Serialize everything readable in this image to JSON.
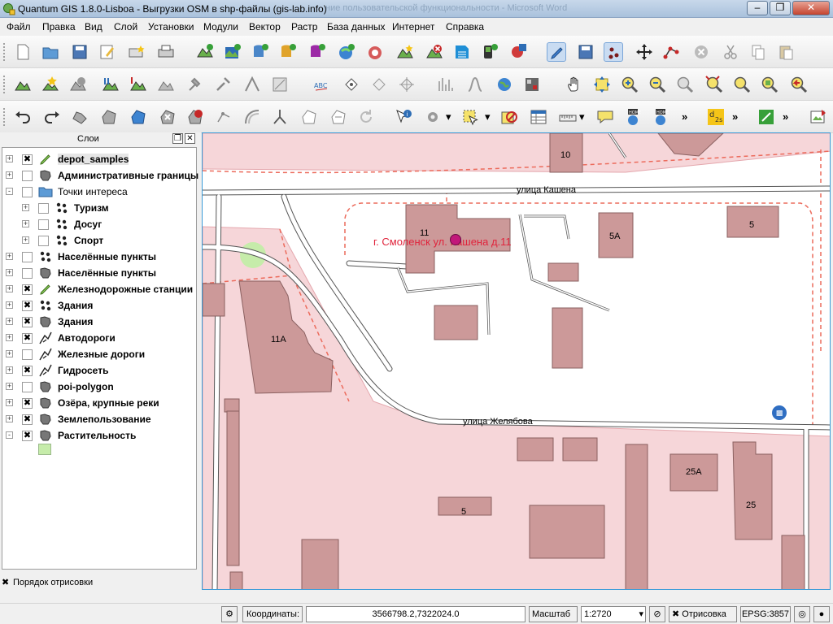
{
  "window": {
    "title": "Quantum GIS 1.8.0-Lisboa - Выгрузки OSM в shp-файлы (gis-lab.info)",
    "background_title": "ние пользовательской функциональности - Microsoft Word"
  },
  "menu": [
    "Файл",
    "Правка",
    "Вид",
    "Слой",
    "Установки",
    "Модули",
    "Вектор",
    "Растр",
    "База данных",
    "Интернет",
    "Справка"
  ],
  "layers_panel": {
    "title": "Слои",
    "items": [
      {
        "name": "depot_samples",
        "checked": true,
        "icon": "pencil-edit-icon",
        "expander": "+",
        "indent": 0,
        "bold": true
      },
      {
        "name": "Административные границы",
        "checked": false,
        "icon": "polygon-layer-icon",
        "expander": "+",
        "indent": 0,
        "bold": true
      },
      {
        "name": "Точки интереса",
        "checked": false,
        "icon": "folder-group-icon",
        "expander": "-",
        "indent": 0,
        "bold": false
      },
      {
        "name": "Туризм",
        "checked": false,
        "icon": "point-layer-icon",
        "expander": "+",
        "indent": 1,
        "bold": true
      },
      {
        "name": "Досуг",
        "checked": false,
        "icon": "point-layer-icon",
        "expander": "+",
        "indent": 1,
        "bold": true
      },
      {
        "name": "Спорт",
        "checked": false,
        "icon": "point-layer-icon",
        "expander": "+",
        "indent": 1,
        "bold": true
      },
      {
        "name": "Населённые пункты",
        "checked": false,
        "icon": "point-layer-icon",
        "expander": "+",
        "indent": 0,
        "bold": true
      },
      {
        "name": "Населённые пункты",
        "checked": false,
        "icon": "polygon-layer-icon",
        "expander": "+",
        "indent": 0,
        "bold": true
      },
      {
        "name": "Железнодорожные станции",
        "checked": true,
        "icon": "pencil-edit-icon",
        "expander": "+",
        "indent": 0,
        "bold": true
      },
      {
        "name": "Здания",
        "checked": true,
        "icon": "point-layer-icon",
        "expander": "+",
        "indent": 0,
        "bold": true
      },
      {
        "name": "Здания",
        "checked": true,
        "icon": "polygon-layer-icon",
        "expander": "+",
        "indent": 0,
        "bold": true
      },
      {
        "name": "Автодороги",
        "checked": true,
        "icon": "line-layer-icon",
        "expander": "+",
        "indent": 0,
        "bold": true
      },
      {
        "name": "Железные дороги",
        "checked": false,
        "icon": "line-layer-icon",
        "expander": "+",
        "indent": 0,
        "bold": true
      },
      {
        "name": "Гидросеть",
        "checked": true,
        "icon": "line-layer-icon",
        "expander": "+",
        "indent": 0,
        "bold": true
      },
      {
        "name": "poi-polygon",
        "checked": false,
        "icon": "polygon-layer-icon",
        "expander": "+",
        "indent": 0,
        "bold": true
      },
      {
        "name": "Озёра, крупные реки",
        "checked": true,
        "icon": "polygon-layer-icon",
        "expander": "+",
        "indent": 0,
        "bold": true
      },
      {
        "name": "Землепользование",
        "checked": true,
        "icon": "polygon-layer-icon",
        "expander": "+",
        "indent": 0,
        "bold": true
      },
      {
        "name": "Растительность",
        "checked": true,
        "icon": "polygon-layer-icon",
        "expander": "-",
        "indent": 0,
        "bold": true
      }
    ],
    "draw_order_label": "Порядок отрисовки",
    "draw_order_checked": true
  },
  "map": {
    "street_labels": [
      "улица Кашена",
      "улица Желябова"
    ],
    "house_numbers": [
      "10",
      "11",
      "5A",
      "5",
      "11A",
      "25A",
      "25",
      "5"
    ],
    "poi_label": "г. Смоленск ул. Кашена д.11",
    "colors": {
      "building": "#cc9999",
      "building_stroke": "#8a6060",
      "landuse": "#f6d6d9",
      "landuse_edge": "#e4a7ad",
      "road": "#ffffff",
      "road_casing": "#555555",
      "boundary": "#ec6b5c",
      "vegetation": "#c6ecaa",
      "poi": "#c2177a",
      "poi_label": "#e0243c"
    }
  },
  "statusbar": {
    "coords_label": "Координаты:",
    "coords_value": "3566798.2,7322024.0",
    "scale_label": "Масштаб",
    "scale_value": "1:2720",
    "render_label": "Отрисовка",
    "render_checked": true,
    "crs_label": "EPSG:3857"
  }
}
